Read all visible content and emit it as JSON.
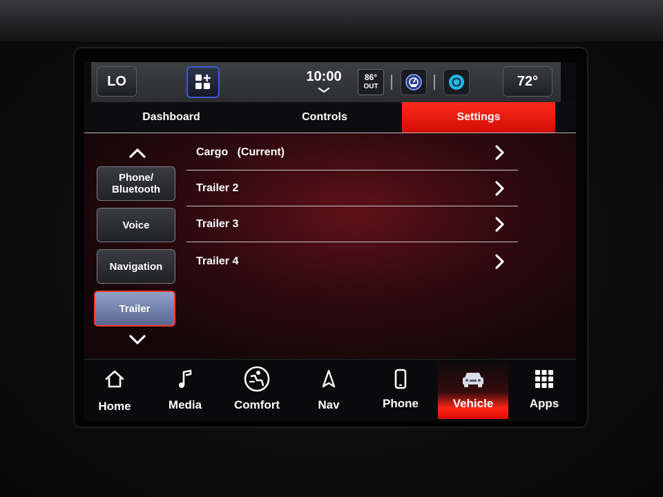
{
  "status": {
    "lo_label": "LO",
    "time": "10:00",
    "time_chevron": "chevron-down-icon",
    "outside_temp": "86°",
    "outside_label": "OUT",
    "cabin_temp": "72°",
    "icons": [
      "grid-plus-icon",
      "gauge-icon",
      "alexa-icon"
    ]
  },
  "tabs": [
    {
      "label": "Dashboard",
      "active": false
    },
    {
      "label": "Controls",
      "active": false
    },
    {
      "label": "Settings",
      "active": true
    }
  ],
  "sidebar": {
    "up_icon": "chevron-up-icon",
    "down_icon": "chevron-down-icon",
    "items": [
      {
        "label": "Phone/\nBluetooth",
        "selected": false
      },
      {
        "label": "Voice",
        "selected": false
      },
      {
        "label": "Navigation",
        "selected": false
      },
      {
        "label": "Trailer",
        "selected": true
      }
    ]
  },
  "list": {
    "items": [
      {
        "label": "Cargo   (Current)",
        "icon": "chevron-right-icon"
      },
      {
        "label": "Trailer 2",
        "icon": "chevron-right-icon"
      },
      {
        "label": "Trailer 3",
        "icon": "chevron-right-icon"
      },
      {
        "label": "Trailer 4",
        "icon": "chevron-right-icon"
      }
    ]
  },
  "dock": {
    "items": [
      {
        "label": "Home",
        "icon": "home-icon",
        "active": false
      },
      {
        "label": "Media",
        "icon": "music-note-icon",
        "active": false
      },
      {
        "label": "Comfort",
        "icon": "comfort-seat-icon",
        "active": false
      },
      {
        "label": "Nav",
        "icon": "nav-arrow-icon",
        "active": false
      },
      {
        "label": "Phone",
        "icon": "phone-icon",
        "active": false
      },
      {
        "label": "Vehicle",
        "icon": "car-icon",
        "active": true
      },
      {
        "label": "Apps",
        "icon": "apps-grid-icon",
        "active": false
      }
    ]
  },
  "colors": {
    "accent_red": "#e8140a",
    "selected_blue": "#7585b0",
    "widget_blue": "#3b5bd6",
    "alexa_cyan": "#1fb8e8"
  }
}
